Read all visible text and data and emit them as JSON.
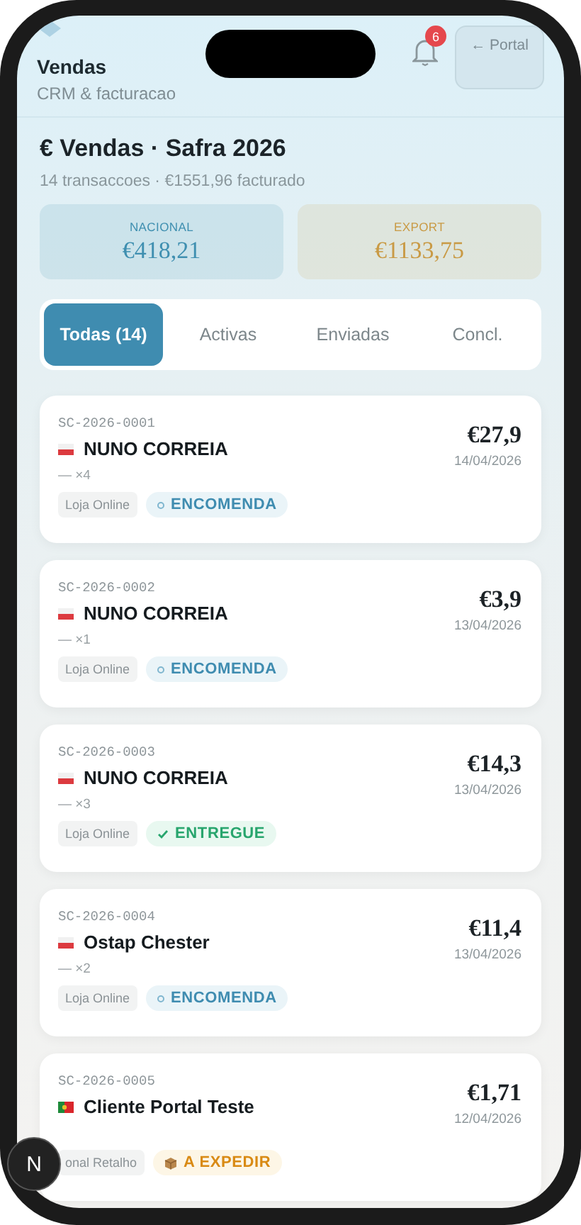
{
  "header": {
    "title": "Vendas",
    "subtitle": "CRM & facturacao",
    "notifications": "6",
    "portal_button": "← Portal"
  },
  "summary": {
    "title": "€ Vendas · Safra 2026",
    "subtitle": "14 transaccoes · €1551,96 facturado",
    "stats": [
      {
        "label": "NACIONAL",
        "value": "€418,21",
        "color": "#3f8fb0"
      },
      {
        "label": "EXPORT",
        "value": "€1133,75",
        "color": "#c99a45"
      }
    ]
  },
  "tabs": [
    {
      "label": "Todas (14)",
      "selected": true
    },
    {
      "label": "Activas",
      "selected": false
    },
    {
      "label": "Enviadas",
      "selected": false
    },
    {
      "label": "Concl.",
      "selected": false
    }
  ],
  "orders": [
    {
      "id": "SC-2026-0001",
      "kind": "pl",
      "customer": "NUNO CORREIA",
      "qty": "— ×4",
      "amount": "€27,9",
      "date": "14/04/2026",
      "channel": "Loja Online",
      "status": {
        "kind": "order",
        "label": "ENCOMENDA"
      }
    },
    {
      "id": "SC-2026-0002",
      "kind": "pl",
      "customer": "NUNO CORREIA",
      "qty": "— ×1",
      "amount": "€3,9",
      "date": "13/04/2026",
      "channel": "Loja Online",
      "status": {
        "kind": "order",
        "label": "ENCOMENDA"
      }
    },
    {
      "id": "SC-2026-0003",
      "kind": "pl",
      "customer": "NUNO CORREIA",
      "qty": "— ×3",
      "amount": "€14,3",
      "date": "13/04/2026",
      "channel": "Loja Online",
      "status": {
        "kind": "delivered",
        "label": "ENTREGUE"
      }
    },
    {
      "id": "SC-2026-0004",
      "kind": "pl",
      "customer": "Ostap Chester",
      "qty": "— ×2",
      "amount": "€11,4",
      "date": "13/04/2026",
      "channel": "Loja Online",
      "status": {
        "kind": "order",
        "label": "ENCOMENDA"
      }
    },
    {
      "id": "SC-2026-0005",
      "kind": "pt",
      "customer": "Cliente Portal Teste",
      "amount": "€1,71",
      "date": "12/04/2026",
      "channel": "onal Retalho",
      "status": {
        "kind": "to-ship",
        "label": "A EXPEDIR"
      }
    }
  ],
  "dev_badge": "N"
}
